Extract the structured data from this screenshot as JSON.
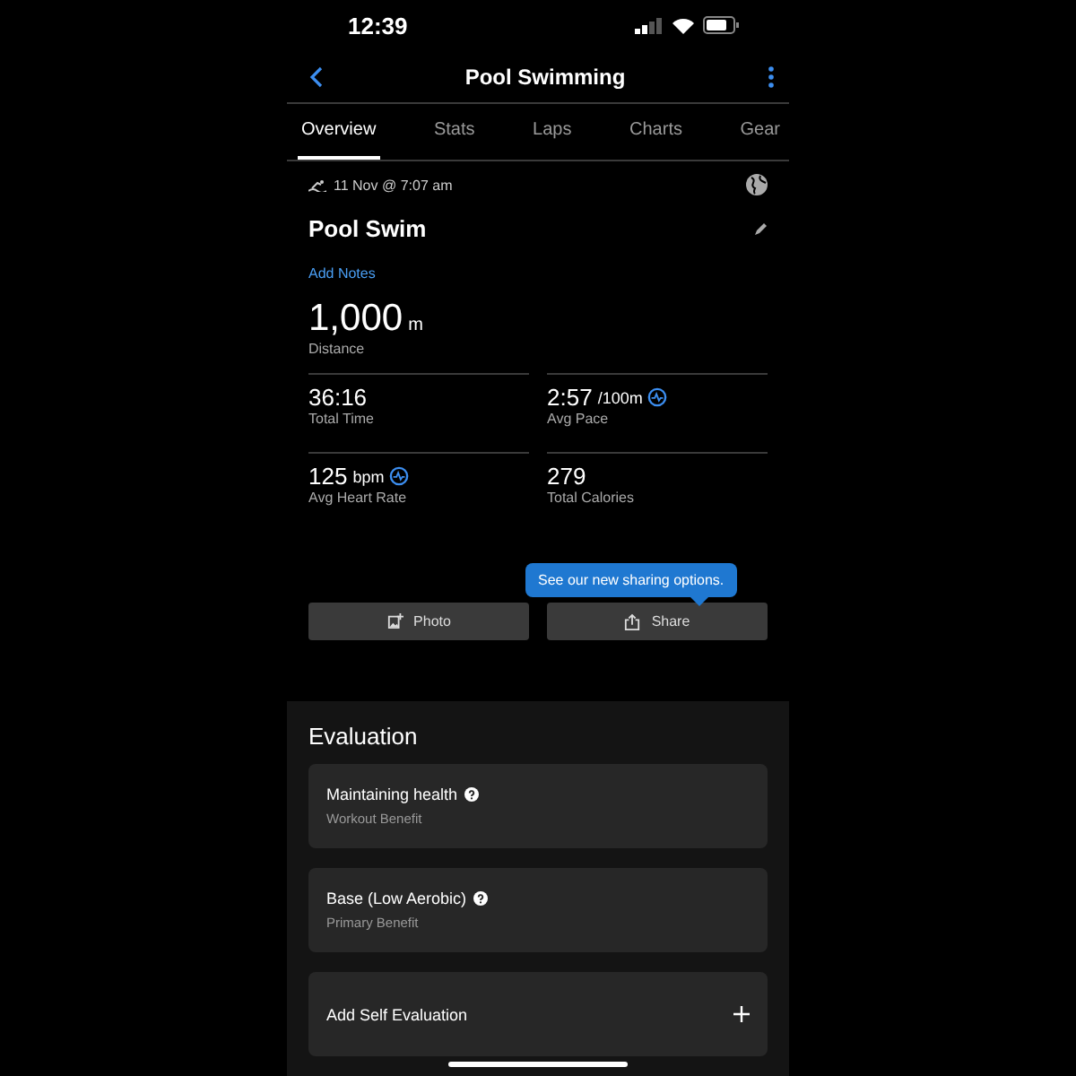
{
  "status_bar": {
    "time": "12:39"
  },
  "header": {
    "title": "Pool Swimming"
  },
  "tabs": [
    {
      "label": "Overview",
      "selected": true
    },
    {
      "label": "Stats",
      "selected": false
    },
    {
      "label": "Laps",
      "selected": false
    },
    {
      "label": "Charts",
      "selected": false
    },
    {
      "label": "Gear",
      "selected": false
    }
  ],
  "activity": {
    "date": "11 Nov @ 7:07 am",
    "name": "Pool Swim",
    "notes_link": "Add Notes",
    "distance": {
      "value": "1,000",
      "unit": "m",
      "label": "Distance"
    }
  },
  "stats": [
    {
      "value": "36:16",
      "label": "Total Time",
      "linked": false
    },
    {
      "value": "2:57",
      "unit": "/100m",
      "label": "Avg Pace",
      "linked": true
    },
    {
      "value": "125",
      "unit": "bpm",
      "label": "Avg Heart Rate",
      "linked": true
    },
    {
      "value": "279",
      "label": "Total Calories",
      "linked": false
    }
  ],
  "tooltip": "See our new sharing options.",
  "actions": [
    {
      "label": "Photo",
      "kind": "photo"
    },
    {
      "label": "Share",
      "kind": "share"
    }
  ],
  "evaluation": {
    "title": "Evaluation",
    "cards": [
      {
        "title": "Maintaining health",
        "subtitle": "Workout Benefit",
        "kind": "info"
      },
      {
        "title": "Base (Low Aerobic)",
        "subtitle": "Primary Benefit",
        "kind": "info"
      },
      {
        "title": "Add Self Evaluation",
        "kind": "add"
      }
    ]
  }
}
